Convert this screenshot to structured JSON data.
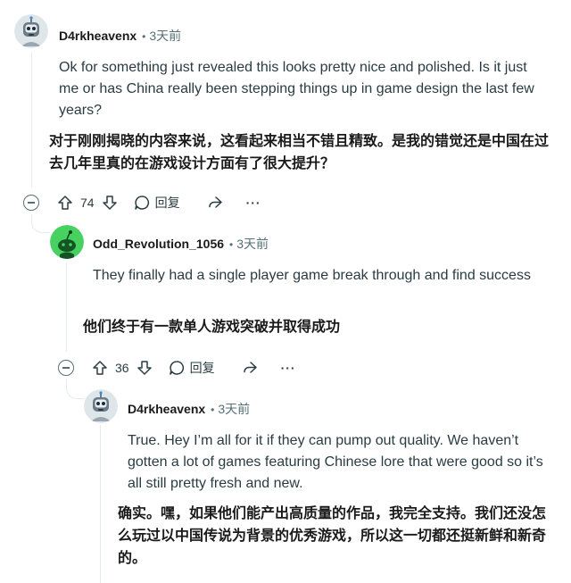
{
  "comments": [
    {
      "author": "D4rkheavenx",
      "time": "3天前",
      "text_en": "Ok for something just revealed this looks pretty nice and polished. Is it just me or has China really been stepping things up in game design the last few years?",
      "text_zh": "对于刚刚揭晓的内容来说，这看起来相当不错且精致。是我的错觉还是中国在过去几年里真的在游戏设计方面有了很大提升？",
      "votes": "74",
      "reply_label": "回复"
    },
    {
      "author": "Odd_Revolution_1056",
      "time": "3天前",
      "text_en": "They finally had a single player game break through and find success",
      "text_zh": "他们终于有一款单人游戏突破并取得成功",
      "votes": "36",
      "reply_label": "回复"
    },
    {
      "author": "D4rkheavenx",
      "time": "3天前",
      "text_en": "True. Hey I’m all for it if they can pump out quality. We haven’t gotten a lot of games featuring Chinese lore that were good so it’s all still pretty fresh and new.",
      "text_zh": "确实。嘿，如果他们能产出高质量的作品，我完全支持。我们还没怎么玩过以中国传说为背景的优秀游戏，所以这一切都还挺新鲜和新奇的。"
    }
  ],
  "separator": "•",
  "colors": {
    "meta_text": "#576f76",
    "thread_line": "#e5ebee",
    "snoo_bg": "#46d160"
  }
}
